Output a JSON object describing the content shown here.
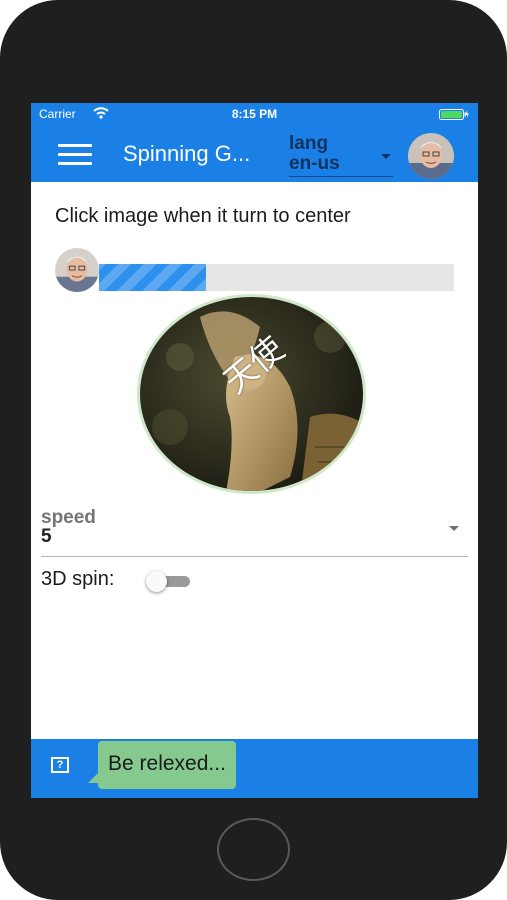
{
  "status_bar": {
    "carrier": "Carrier",
    "time": "8:15 PM",
    "icons": [
      "wifi-icon",
      "battery-icon"
    ],
    "battery_color": "#4cd964"
  },
  "app_bar": {
    "title": "Spinning G...",
    "menu_icon": "hamburger-menu-icon",
    "lang": {
      "label": "lang",
      "value": "en-us"
    },
    "avatar": "user-avatar",
    "background_color": "#1a80e6"
  },
  "content": {
    "instruction": "Click image when it turn to center",
    "progress": {
      "fraction": 0.3,
      "fill_color": "#2e90ed"
    },
    "spin_image": {
      "text": "天使",
      "subject": "angel statue"
    },
    "speed": {
      "label": "speed",
      "value": "5"
    },
    "spin_3d": {
      "label": "3D spin:",
      "enabled": false
    }
  },
  "bottom_bar": {
    "help_icon_glyph": "?",
    "message": "Be relexed..."
  }
}
